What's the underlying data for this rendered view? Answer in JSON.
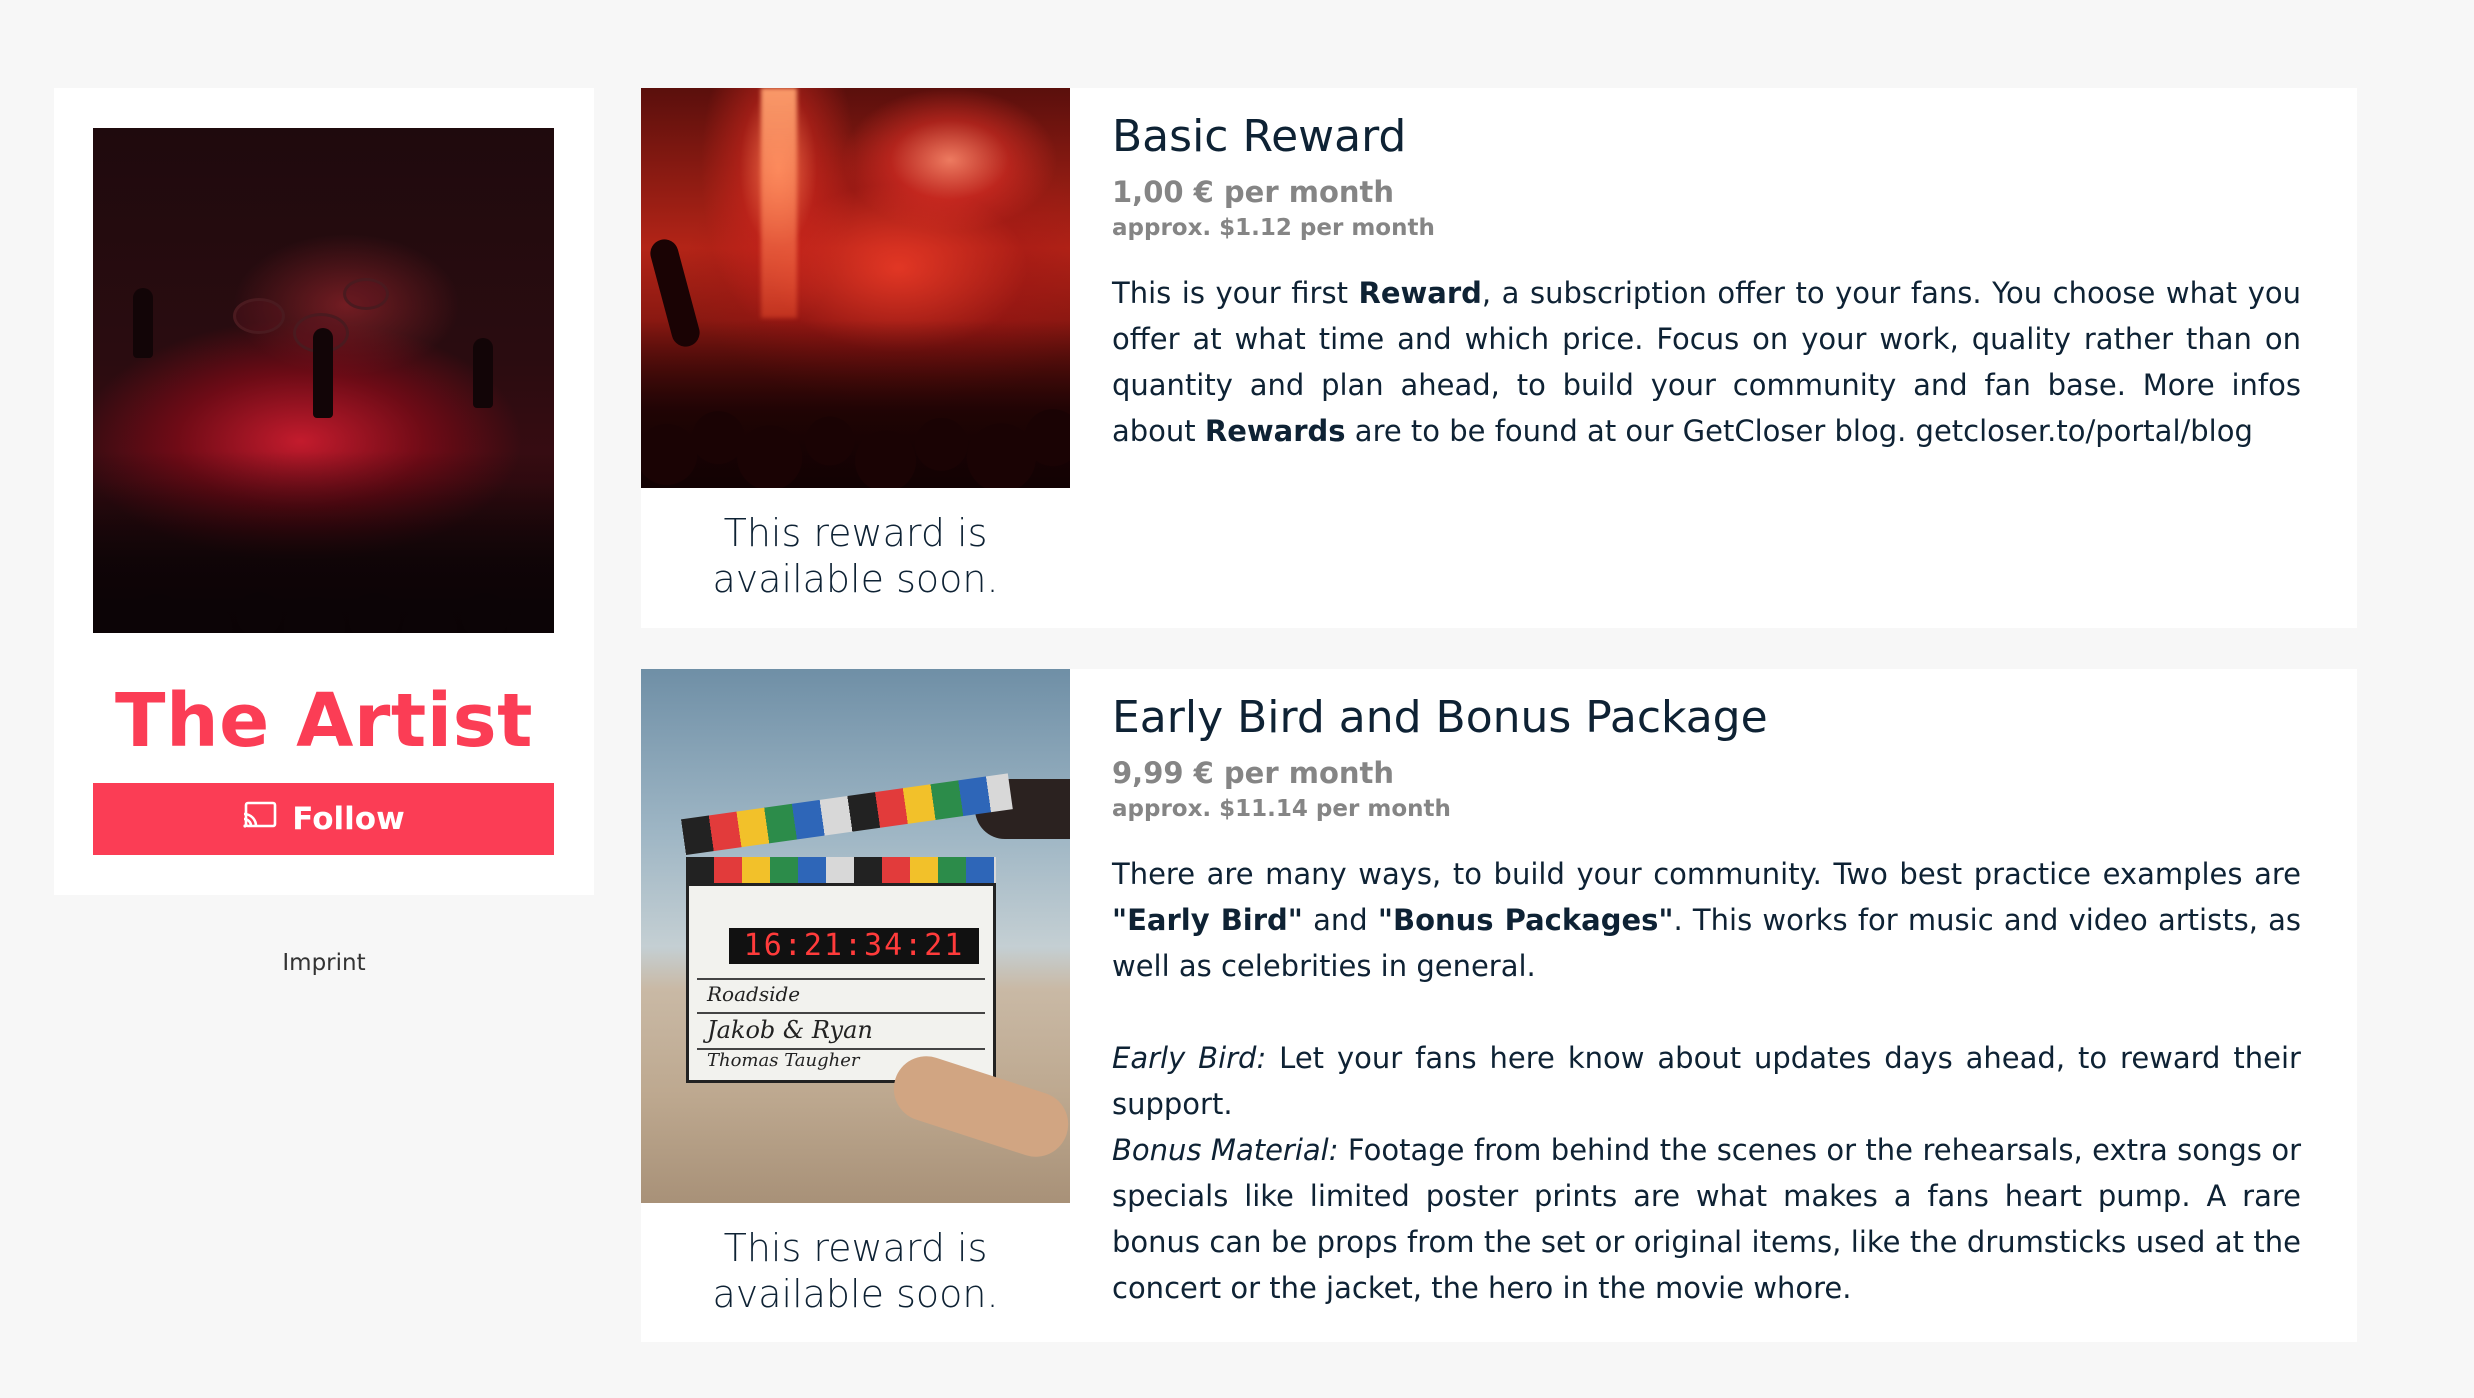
{
  "sidebar": {
    "artist_name": "The Artist",
    "follow_label": "Follow",
    "imprint_label": "Imprint"
  },
  "rewards": [
    {
      "title": "Basic Reward",
      "price": "1,00 € per month",
      "approx": "approx. $1.12 per month",
      "availability": "This reward is available soon.",
      "desc_1": "This is your first ",
      "desc_bold_1": "Reward",
      "desc_2": ", a subscription offer to your fans. You choose what you offer at what time and which price. Focus on your work, quality rather than on quantity and plan ahead, to build your community and fan base. More infos about ",
      "desc_bold_2": "Rewards",
      "desc_3": " are to be found at our GetCloser blog. getcloser.to/portal/blog"
    },
    {
      "title": "Early Bird and Bonus Package",
      "price": "9,99 € per month",
      "approx": "approx. $11.14 per month",
      "availability": "This reward is available soon.",
      "p1_a": "There are many ways, to build your community. Two best practice examples are ",
      "p1_bold_a": "\"Early Bird\"",
      "p1_b": " and ",
      "p1_bold_b": "\"Bonus Packages\"",
      "p1_c": ". This works for music and video artists, as well as celebrities in general.",
      "early_label": "Early Bird:",
      "early_text": " Let your fans here know about updates days ahead, to reward their support.",
      "bonus_label": "Bonus Material:",
      "bonus_text": " Footage from behind the scenes or the rehearsals, extra songs or specials like limited poster prints are what makes a fans heart pump. A rare bonus can be props from the set or original items, like the drumsticks used at the concert or the jacket, the hero in the movie whore."
    }
  ],
  "clapper": {
    "display": "16:21:34:21",
    "line1": "Roadside",
    "line2": "Jakob & Ryan",
    "line3": "Thomas Taugher"
  },
  "icons": {
    "follow": "cast-icon"
  },
  "colors": {
    "accent": "#fb3d55",
    "text": "#0e2234",
    "muted": "#858585",
    "background": "#f7f7f7"
  }
}
